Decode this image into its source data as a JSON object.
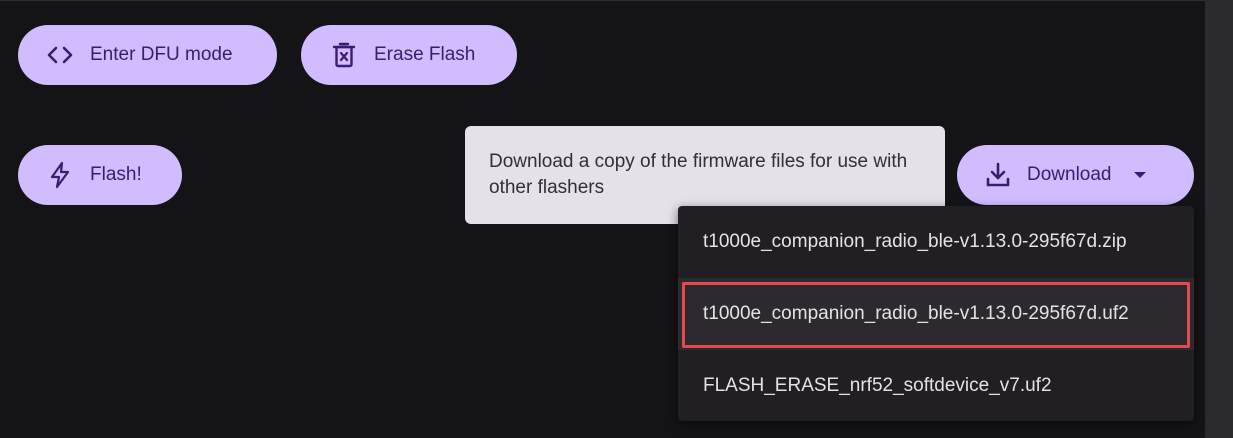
{
  "colors": {
    "background": "#141416",
    "button_bg": "#d0bcff",
    "button_text": "#381e72",
    "tooltip_bg": "#e6e0e9",
    "menu_bg": "#211f23",
    "highlight": "#e5484d"
  },
  "actions": {
    "dfu": {
      "label": "Enter DFU mode",
      "icon": "code-brackets-icon"
    },
    "erase": {
      "label": "Erase Flash",
      "icon": "trash-icon"
    },
    "flash": {
      "label": "Flash!",
      "icon": "lightning-icon"
    },
    "download": {
      "label": "Download",
      "icon": "download-icon",
      "caret_icon": "caret-down-icon"
    }
  },
  "tooltip": {
    "text": "Download a copy of the firmware files for use with other flashers"
  },
  "download_menu": {
    "items": [
      {
        "label": "t1000e_companion_radio_ble-v1.13.0-295f67d.zip"
      },
      {
        "label": "t1000e_companion_radio_ble-v1.13.0-295f67d.uf2",
        "highlighted": true
      },
      {
        "label": "FLASH_ERASE_nrf52_softdevice_v7.uf2"
      }
    ]
  }
}
